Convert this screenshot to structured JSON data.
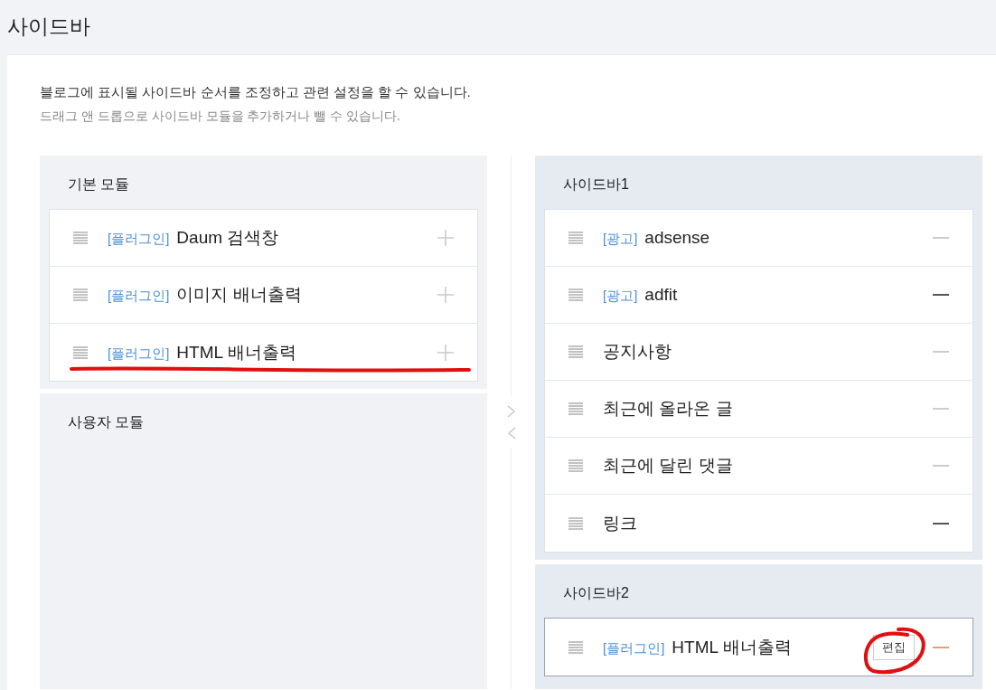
{
  "page_title": "사이드바",
  "description": {
    "primary": "블로그에 표시될 사이드바 순서를 조정하고 관련 설정을 할 수 있습니다.",
    "secondary": "드래그 앤 드롭으로 사이드바 모듈을 추가하거나 뺄 수 있습니다."
  },
  "module_groups": [
    {
      "title": "기본 모듈",
      "items": [
        {
          "tag": "[플러그인]",
          "name": "Daum 검색창"
        },
        {
          "tag": "[플러그인]",
          "name": "이미지 배너출력"
        },
        {
          "tag": "[플러그인]",
          "name": "HTML 배너출력"
        }
      ]
    },
    {
      "title": "사용자 모듈"
    }
  ],
  "sidebars": [
    {
      "title": "사이드바1",
      "items": [
        {
          "tag": "[광고]",
          "name": "adsense",
          "highlighted": false,
          "hovered": false
        },
        {
          "tag": "[광고]",
          "name": "adfit",
          "highlighted": true,
          "hovered": false
        },
        {
          "name": "공지사항",
          "highlighted": false,
          "hovered": false
        },
        {
          "name": "최근에 올라온 글",
          "highlighted": false,
          "hovered": false
        },
        {
          "name": "최근에 달린 댓글",
          "highlighted": false,
          "hovered": false
        },
        {
          "name": "링크",
          "highlighted": true,
          "hovered": false
        }
      ]
    },
    {
      "title": "사이드바2",
      "items": [
        {
          "tag": "[플러그인]",
          "name": "HTML 배너출력",
          "highlighted": false,
          "hovered": true,
          "edit_label": "편집"
        }
      ]
    }
  ]
}
